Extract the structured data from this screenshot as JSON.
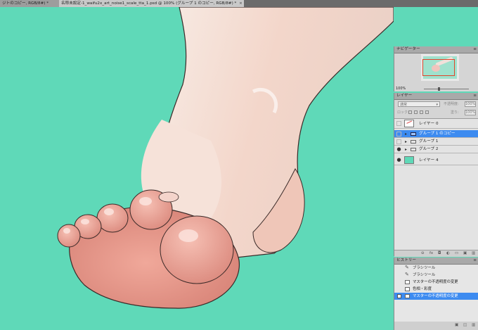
{
  "tabs": [
    {
      "label": "ジトのコピー, RGB/8#) *",
      "close": "×"
    },
    {
      "label": "名称未設定-1_waifu2x_art_noise1_scale_tta_1.psd @ 100% (グループ 1 のコピー, RGB/8#) *",
      "close": "×"
    }
  ],
  "navigator": {
    "title": "ナビゲーター",
    "zoom": "100%",
    "zoom_level": 1.0
  },
  "layers_panel": {
    "title": "レイヤー",
    "blend_mode": "通常",
    "opacity_label": "不透明度:",
    "opacity": "100%",
    "lock_label": "ロック:",
    "fill_label": "塗り:",
    "fill": "100%",
    "layers": [
      {
        "name": "レイヤー 0",
        "visible": false,
        "type": "layer",
        "selected": false
      },
      {
        "name": "グループ 1 のコピー",
        "visible": false,
        "type": "group",
        "selected": true
      },
      {
        "name": "グループ 1",
        "visible": false,
        "type": "group",
        "selected": false
      },
      {
        "name": "グループ 2",
        "visible": true,
        "type": "group",
        "selected": false
      },
      {
        "name": "レイヤー 4",
        "visible": true,
        "type": "layer",
        "selected": false
      }
    ],
    "footer_icons": [
      "link-icon",
      "fx-icon",
      "mask-icon",
      "adjustment-icon",
      "folder-icon",
      "new-layer-icon",
      "trash-icon"
    ],
    "footer_glyphs": [
      "⊖",
      "fx",
      "◘",
      "◐",
      "▭",
      "▣",
      "▥"
    ]
  },
  "history_panel": {
    "title": "ヒストリー",
    "items": [
      {
        "label": "ブラシツール",
        "icon": "brush-icon",
        "selected": false
      },
      {
        "label": "ブラシツール",
        "icon": "brush-icon",
        "selected": false
      },
      {
        "label": "マスターの不透明度の変更",
        "icon": "document-icon",
        "selected": false
      },
      {
        "label": "色相・彩度",
        "icon": "document-icon",
        "selected": false
      },
      {
        "label": "マスターの不透明度の変更",
        "icon": "document-icon",
        "selected": true
      }
    ],
    "footer_glyphs": [
      "▣",
      "◫",
      "▥"
    ]
  },
  "colors": {
    "canvas_background": "#5fd9b8",
    "selection": "#3d8bf0",
    "panel": "#d5d5d5",
    "skin": "#f4d8cf",
    "toe_pink": "#e69a8e"
  }
}
